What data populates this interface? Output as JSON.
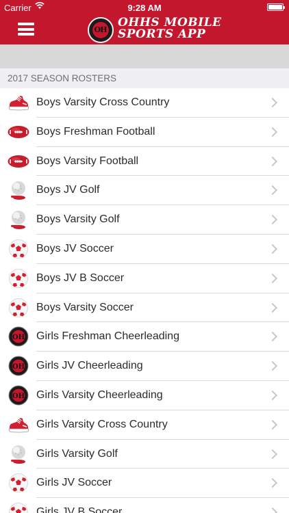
{
  "status_bar": {
    "carrier": "Carrier",
    "time": "9:28 AM"
  },
  "header": {
    "logo_text": "OH",
    "title_line1": "OHHS MOBILE",
    "title_line2": "SPORTS APP",
    "brand_color": "#c2172d"
  },
  "section": {
    "title": "2017 SEASON ROSTERS"
  },
  "rows": [
    {
      "label": "Boys Varsity Cross Country",
      "icon": "running-shoe-icon"
    },
    {
      "label": "Boys Freshman Football",
      "icon": "football-icon"
    },
    {
      "label": "Boys Varsity Football",
      "icon": "football-icon"
    },
    {
      "label": "Boys JV Golf",
      "icon": "golf-ball-icon"
    },
    {
      "label": "Boys Varsity Golf",
      "icon": "golf-ball-icon"
    },
    {
      "label": "Boys JV Soccer",
      "icon": "soccer-ball-icon"
    },
    {
      "label": "Boys JV B Soccer",
      "icon": "soccer-ball-icon"
    },
    {
      "label": "Boys Varsity Soccer",
      "icon": "soccer-ball-icon"
    },
    {
      "label": "Girls Freshman Cheerleading",
      "icon": "school-logo-icon"
    },
    {
      "label": "Girls JV Cheerleading",
      "icon": "school-logo-icon"
    },
    {
      "label": "Girls Varsity Cheerleading",
      "icon": "school-logo-icon"
    },
    {
      "label": "Girls Varsity Cross Country",
      "icon": "running-shoe-icon"
    },
    {
      "label": "Girls Varsity Golf",
      "icon": "golf-ball-icon"
    },
    {
      "label": "Girls JV Soccer",
      "icon": "soccer-ball-icon"
    },
    {
      "label": "Girls JV B Soccer",
      "icon": "soccer-ball-icon"
    }
  ]
}
